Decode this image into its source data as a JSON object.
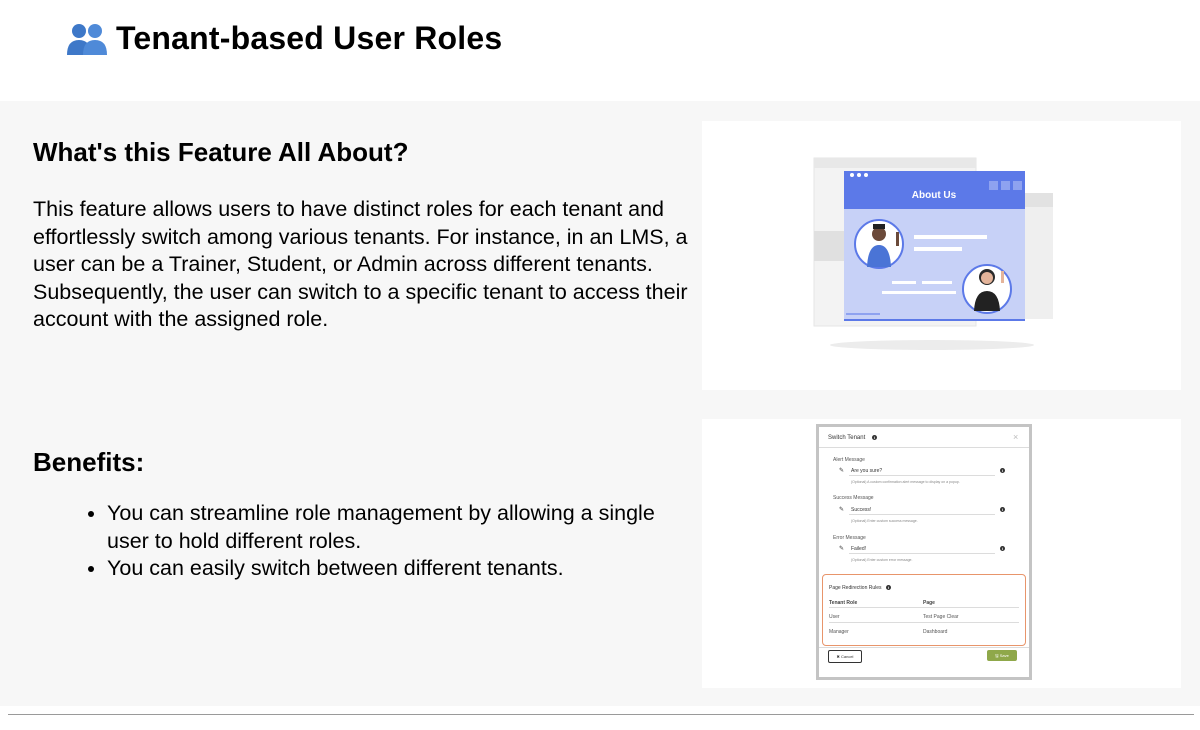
{
  "page": {
    "title": "Tenant-based User Roles",
    "title_icon": "users-icon"
  },
  "about": {
    "heading": "What's this Feature All About?",
    "body": "This feature allows users to have distinct roles for each tenant and effortlessly switch among various tenants. For instance, in an LMS, a user can be a Trainer, Student, or Admin across different tenants. Subsequently, the user can switch to a specific tenant to access their account with the assigned role.",
    "illustration": {
      "banner_text": "About Us"
    }
  },
  "benefits": {
    "heading": "Benefits:",
    "items": [
      "You can streamline role management by allowing a single user to hold different roles.",
      "You can easily switch between different tenants."
    ]
  },
  "modal": {
    "title": "Switch Tenant",
    "close": "×",
    "alert": {
      "label": "Alert Message",
      "value": "Are you sure?",
      "hint": "(Optional) A custom confirmation alert message to display on a popup."
    },
    "success": {
      "label": "Success Message",
      "value": "Success!",
      "hint": "(Optional) Enter custom success message."
    },
    "error": {
      "label": "Error Message",
      "value": "Failed!",
      "hint": "(Optional) Enter custom error message."
    },
    "rules": {
      "title": "Page Redirection Rules",
      "col_role": "Tenant Role",
      "col_page": "Page",
      "rows": [
        {
          "role": "User",
          "page": "Test Page Clear"
        },
        {
          "role": "Manager",
          "page": "Dashboard"
        }
      ]
    },
    "cancel_label": "✖ Cancel",
    "save_label": "🖫 Save"
  },
  "colors": {
    "accent_blue": "#5c79e8",
    "highlight_orange": "#e8956b",
    "save_green": "#8fa84a"
  }
}
